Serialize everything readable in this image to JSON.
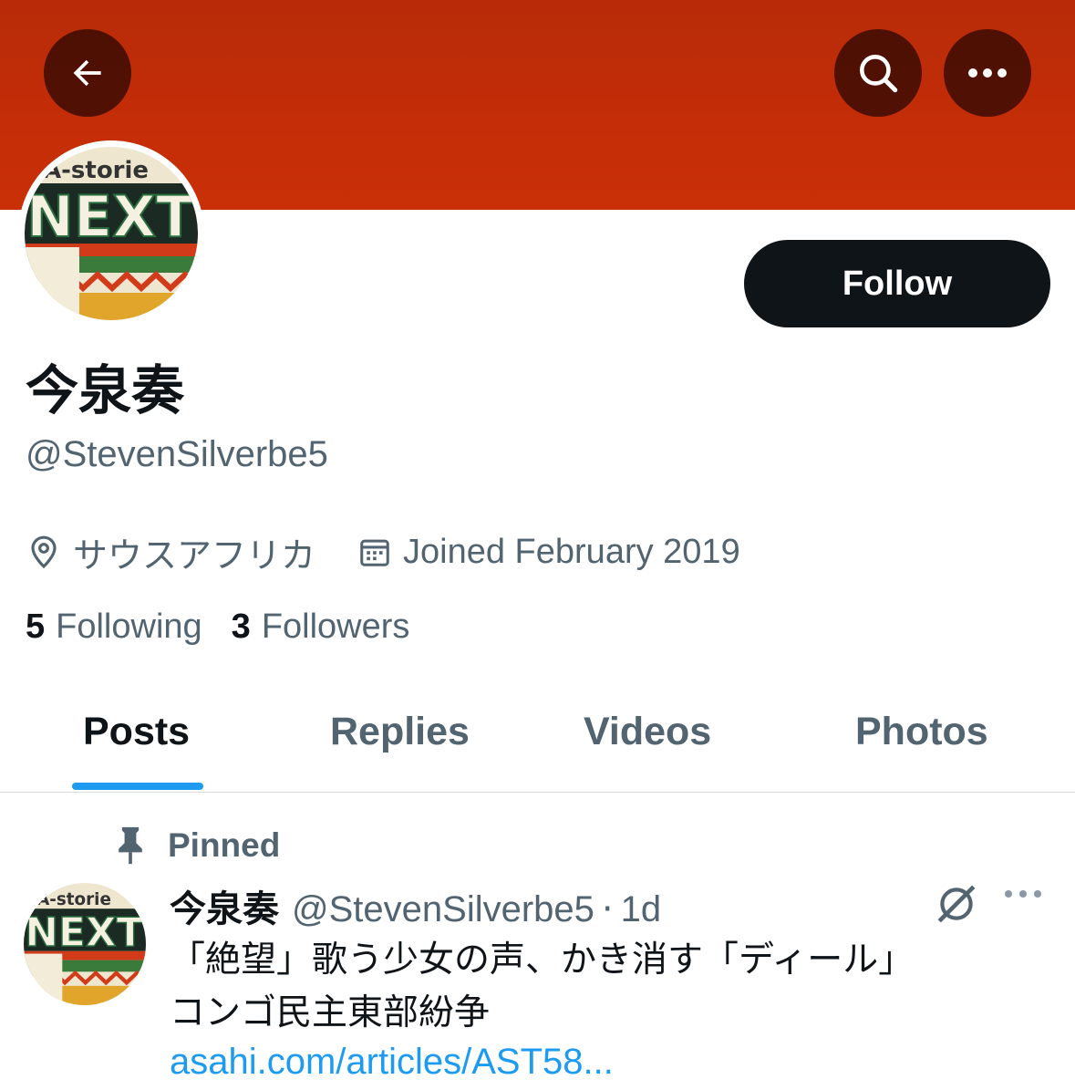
{
  "header": {
    "banner_color": "#c32e07",
    "back_icon": "arrow-left-icon",
    "search_icon": "search-icon",
    "more_icon": "more-horizontal-icon"
  },
  "avatar": {
    "text_top": "A-storie",
    "text_main": "NEXT"
  },
  "profile": {
    "follow_label": "Follow",
    "display_name": "今泉奏",
    "handle": "@StevenSilverbe5",
    "location": "サウスアフリカ",
    "joined": "Joined February 2019",
    "following_count": "5",
    "following_label": "Following",
    "followers_count": "3",
    "followers_label": "Followers"
  },
  "tabs": [
    {
      "label": "Posts",
      "active": true
    },
    {
      "label": "Replies",
      "active": false
    },
    {
      "label": "Videos",
      "active": false
    },
    {
      "label": "Photos",
      "active": false
    }
  ],
  "post": {
    "pinned_label": "Pinned",
    "author_name": "今泉奏",
    "author_handle": "@StevenSilverbe5",
    "separator": "·",
    "time": "1d",
    "text_line1": "「絶望」歌う少女の声、かき消す「ディール」",
    "text_line2": "コンゴ民主東部紛争",
    "link": "asahi.com/articles/AST58..."
  },
  "colors": {
    "accent": "#1d9bf0",
    "text_primary": "#0f1419",
    "text_secondary": "#536471"
  }
}
